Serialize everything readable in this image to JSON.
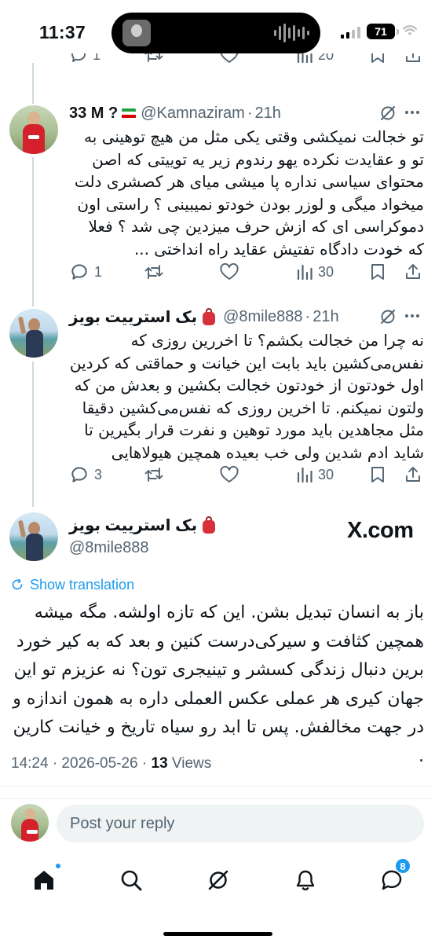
{
  "status_bar": {
    "time": "11:37",
    "battery": "71"
  },
  "top_partial_actions": {
    "reply_count": "1",
    "views": "20"
  },
  "tweets": [
    {
      "name": "33 M ?",
      "handle": "@Kamnaziram",
      "separator": "·",
      "time": "21h",
      "text": "تو خجالت نمیکشی وقتی یکی مثل من هیچ توهینی به تو و عقایدت نکرده یهو رندوم زیر یه توییتی که اصن محتوای سیاسی نداره پا میشی میای هر کصشری دلت میخواد میگی و لوزر بودن خودتو نمیبینی ؟ راستی اون دموکراسی ای که ازش حرف میزدین چی شد ؟ فعلا که خودت دادگاه تفتیش عقاید راه انداختی ...",
      "replies": "1",
      "reposts": "",
      "likes": "",
      "views": "30"
    },
    {
      "name": "بک استرییت بویز",
      "handle": "@8mile888",
      "separator": "·",
      "time": "21h",
      "text": "نه چرا من خجالت بکشم؟ تا اخررین روزی که نفس‌می‌کشین باید بابت این خیانت و حماقتی که کردین اول خودتون از خودتون خجالت بکشین و بعدش من که ولتون نمیکنم. تا اخرین روزی که نفس‌می‌کشین دقیقا مثل مجاهدین باید مورد توهین و نفرت قرار بگیرین تا شاید ادم شدین ولی خب بعیده همچین هیولاهایی",
      "replies": "3",
      "reposts": "",
      "likes": "",
      "views": "30"
    }
  ],
  "focused_tweet": {
    "name": "بک استرییت بویز",
    "handle": "@8mile888",
    "source_logo": "X.com",
    "show_translation": "Show translation",
    "text": "باز به انسان تبدیل بشن. این که تازه اولشه. مگه میشه همچین کثافت و سیرکی‌درست کنین و بعد که به کیر خورد برین دنبال زندگی کسشر و تینیجری تون؟ نه عزیزم تو این جهان کیری هر عملی عکس العملی داره به همون اندازه و در جهت مخالفش. پس تا ابد رو سیاه تاریخ و خیانت کارین .",
    "timestamp": "14:24 · 2026-05-26 · ",
    "views_count": "13",
    "views_label": " Views"
  },
  "reply_bar": {
    "placeholder": "Post your reply"
  },
  "bottom_nav": {
    "messages_badge": "8"
  },
  "colors": {
    "accent": "#1d9bf0",
    "secondary_text": "#536471",
    "divider": "#eff3f4"
  },
  "icons": [
    "home-icon",
    "search-icon",
    "grok-icon",
    "bell-icon",
    "messages-icon",
    "reply-icon",
    "repost-icon",
    "like-icon",
    "views-icon",
    "bookmark-icon",
    "share-icon",
    "more-icon",
    "translate-icon"
  ]
}
